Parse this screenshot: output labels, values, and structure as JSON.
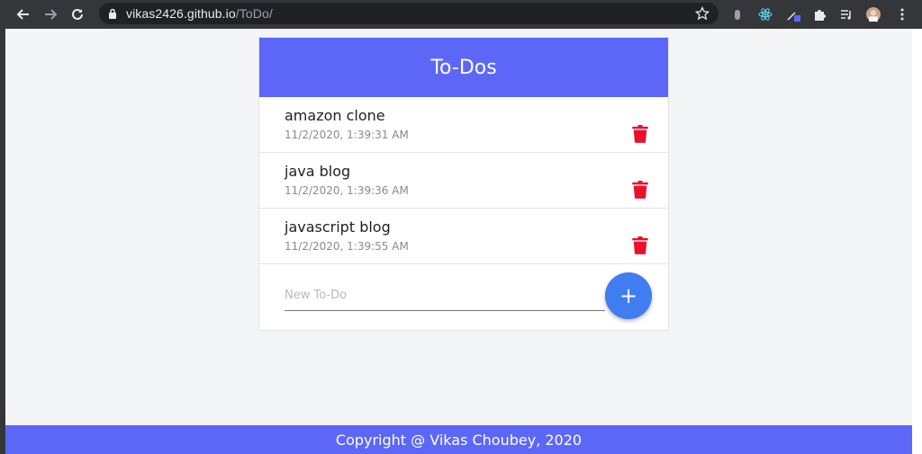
{
  "browser": {
    "url_host": "vikas2426.github.io",
    "url_path": "/ToDo/",
    "icons": [
      "back-arrow-icon",
      "forward-arrow-icon",
      "reload-icon",
      "lock-icon",
      "star-icon",
      "extension-icon",
      "react-devtools-icon",
      "color-picker-icon",
      "puzzle-icon",
      "media-control-icon",
      "profile-avatar-icon",
      "kebab-menu-icon"
    ]
  },
  "app": {
    "title": "To-Dos",
    "todos": [
      {
        "title": "amazon clone",
        "time": "11/2/2020, 1:39:31 AM"
      },
      {
        "title": "java blog",
        "time": "11/2/2020, 1:39:36 AM"
      },
      {
        "title": "javascript blog",
        "time": "11/2/2020, 1:39:55 AM"
      }
    ],
    "new_placeholder": "New To-Do",
    "add_label": "+"
  },
  "footer": {
    "text": "Copyright @ Vikas Choubey, 2020"
  },
  "colors": {
    "header": "#5c67f8",
    "add_button": "#3f7df0",
    "delete": "#e8122d",
    "chrome": "#35363a"
  }
}
